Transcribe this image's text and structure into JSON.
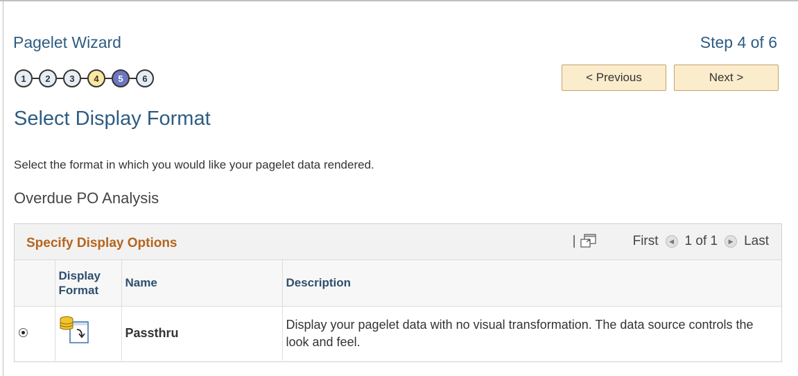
{
  "wizard": {
    "title": "Pagelet Wizard",
    "step_text": "Step 4 of 6",
    "steps": [
      {
        "label": "1",
        "state": "default"
      },
      {
        "label": "2",
        "state": "default"
      },
      {
        "label": "3",
        "state": "default"
      },
      {
        "label": "4",
        "state": "current"
      },
      {
        "label": "5",
        "state": "visited"
      },
      {
        "label": "6",
        "state": "default"
      }
    ],
    "previous_label": "< Previous",
    "next_label": "Next >"
  },
  "page": {
    "heading": "Select Display Format",
    "instructions": "Select the format in which you would like your pagelet data rendered.",
    "analysis_name": "Overdue PO Analysis"
  },
  "grid": {
    "title": "Specify Display Options",
    "zoom_icon": "zoom-icon",
    "nav": {
      "first": "First",
      "range": "1 of 1",
      "last": "Last"
    },
    "columns": {
      "display_format": "Display Format",
      "name": "Name",
      "description": "Description"
    },
    "rows": [
      {
        "selected": true,
        "icon": "passthru-format-icon",
        "name": "Passthru",
        "description": "Display your pagelet data with no visual transformation.  The data source controls the look and feel."
      }
    ]
  },
  "colors": {
    "title_blue": "#2e5c82",
    "grid_title_orange": "#b5651d",
    "button_bg": "#fbeccc",
    "current_step": "#fbe7a0",
    "visited_step": "#6d78c0"
  }
}
